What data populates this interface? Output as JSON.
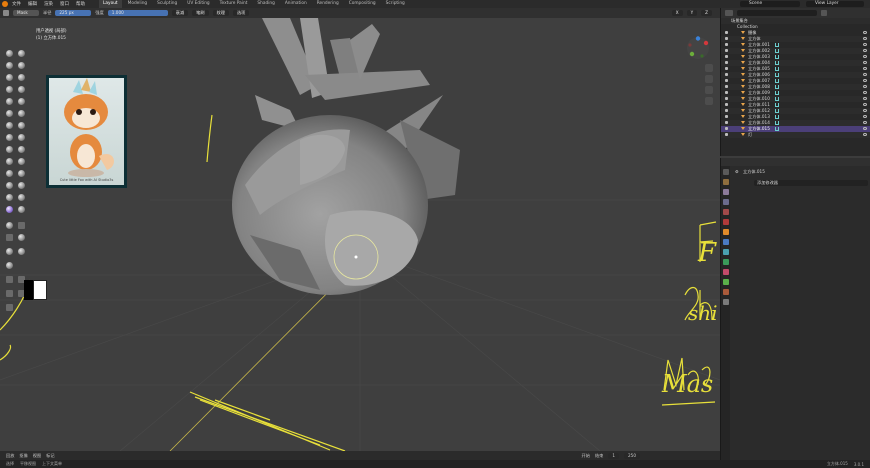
{
  "menu": {
    "items": [
      "文件",
      "编辑",
      "渲染",
      "窗口",
      "帮助"
    ],
    "tabs": [
      "Layout",
      "Modeling",
      "Sculpting",
      "UV Editing",
      "Texture Paint",
      "Shading",
      "Animation",
      "Rendering",
      "Compositing",
      "Scripting"
    ],
    "active_tab": "Layout",
    "scene_label": "Scene",
    "view_layer_label": "View Layer"
  },
  "tool_header": {
    "mode": "Mask",
    "radius_label": "半径",
    "radius_value": "225 px",
    "strength_label": "强度",
    "strength_value": "1.000",
    "falloff_label": "衰减",
    "cursor_label": "笔刷",
    "texture_label": "纹理",
    "options_label": "选项",
    "x_label": "X",
    "y_label": "Y",
    "z_label": "Z"
  },
  "viewport": {
    "title_line1": "用户透视 (局部)",
    "title_line2": "(1) 立方体.015",
    "reference_caption": "Cute little Fox with AI Studio3s",
    "annotations": [
      "F",
      "shi",
      "Mas"
    ]
  },
  "outliner": {
    "header_label": "场景集合",
    "search_placeholder": "",
    "collection": "Collection",
    "rows": [
      {
        "name": "摄像",
        "selected": false
      },
      {
        "name": "立方体",
        "selected": false
      },
      {
        "name": "立方体.001",
        "selected": false
      },
      {
        "name": "立方体.002",
        "selected": false
      },
      {
        "name": "立方体.003",
        "selected": false
      },
      {
        "name": "立方体.004",
        "selected": false
      },
      {
        "name": "立方体.005",
        "selected": false
      },
      {
        "name": "立方体.006",
        "selected": false
      },
      {
        "name": "立方体.007",
        "selected": false
      },
      {
        "name": "立方体.008",
        "selected": false
      },
      {
        "name": "立方体.009",
        "selected": false
      },
      {
        "name": "立方体.010",
        "selected": false
      },
      {
        "name": "立方体.011",
        "selected": false
      },
      {
        "name": "立方体.012",
        "selected": false
      },
      {
        "name": "立方体.013",
        "selected": false
      },
      {
        "name": "立方体.014",
        "selected": false
      },
      {
        "name": "立方体.015",
        "selected": true
      },
      {
        "name": "灯",
        "selected": false
      }
    ]
  },
  "properties": {
    "object_name": "立方体.015",
    "add_modifier_label": "添加修改器"
  },
  "timeline": {
    "items": [
      "回放",
      "抠像",
      "视图",
      "标记",
      "开始",
      "结束",
      "1",
      "250"
    ]
  },
  "status": {
    "items": [
      "选择",
      "平移视图",
      "上下文菜单",
      "立方体.015",
      "3.0.1"
    ]
  },
  "colors": {
    "accent": "#4772b3",
    "selection": "#4b3f78",
    "annotation": "#e8e03a",
    "mesh": "#8a8a8a"
  }
}
